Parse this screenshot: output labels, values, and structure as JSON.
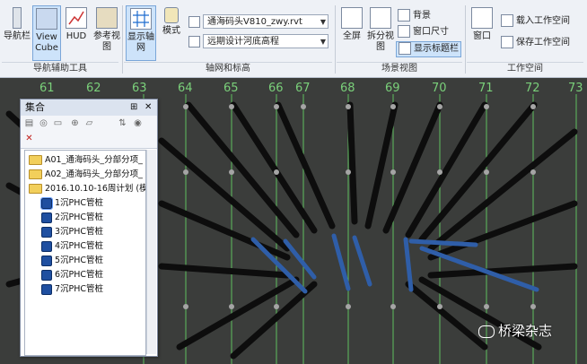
{
  "ribbon": {
    "nav_group": {
      "title": "导航辅助工具",
      "buttons": [
        {
          "label": "导航栏",
          "icon": "navbar-icon"
        },
        {
          "label": "View Cube",
          "icon": "viewcube-icon"
        },
        {
          "label": "HUD",
          "icon": "hud-icon"
        },
        {
          "label": "参考视图",
          "icon": "reference-view-icon"
        }
      ]
    },
    "grid_group": {
      "title": "轴网和标高",
      "show_grid_label": "显示轴网",
      "mode_label": "模式",
      "file_combo": "通海码头V810_zwy.rvt",
      "level_combo": "远期设计河底高程"
    },
    "scene_group": {
      "title": "场景视图",
      "fullscreen_label": "全屏",
      "split_label": "拆分视图",
      "background_label": "背景",
      "window_size_label": "窗口尺寸",
      "show_title_label": "显示标题栏"
    },
    "workspace_group": {
      "title": "工作空间",
      "window_label": "窗口",
      "load_label": "载入工作空间",
      "save_label": "保存工作空间"
    }
  },
  "grid_numbers": [
    "61",
    "62",
    "63",
    "64",
    "65",
    "66",
    "67",
    "68",
    "69",
    "70",
    "71",
    "72",
    "73"
  ],
  "panel": {
    "title": "集合",
    "items": [
      {
        "label": "A01_通海码头_分部分项_",
        "type": "folder"
      },
      {
        "label": "A02_通海码头_分部分项_",
        "type": "folder"
      },
      {
        "label": "2016.10.10-16周计划 (模)",
        "type": "folder"
      },
      {
        "label": "1沉PHC管桩",
        "type": "leaf"
      },
      {
        "label": "2沉PHC管桩",
        "type": "leaf"
      },
      {
        "label": "3沉PHC管桩",
        "type": "leaf"
      },
      {
        "label": "4沉PHC管桩",
        "type": "leaf"
      },
      {
        "label": "5沉PHC管桩",
        "type": "leaf"
      },
      {
        "label": "6沉PHC管桩",
        "type": "leaf"
      },
      {
        "label": "7沉PHC管桩",
        "type": "leaf"
      }
    ]
  },
  "watermark": "桥梁杂志"
}
